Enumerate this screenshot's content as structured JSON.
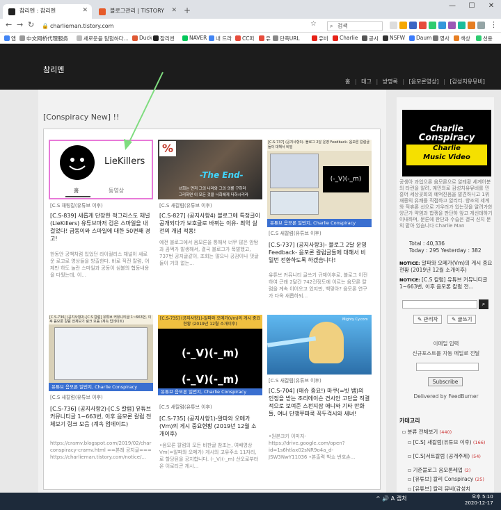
{
  "browser": {
    "tabs": [
      {
        "label": "참리멘 : 참리멘"
      },
      {
        "label": "블로그관리 | TISTORY"
      }
    ],
    "new_tab": "+",
    "url": "charlieman.tistory.com",
    "search_placeholder": "검색",
    "window_controls": [
      "—",
      "☐",
      "✕"
    ],
    "bookmarks": [
      "앱",
      "中文网桥代理服务",
      "새로운을 탐험하다...",
      "Duck",
      "잘리엔",
      "NAVER",
      "내 드라",
      "CC퍼",
      "유",
      "단축URL",
      "유비",
      "Charlie",
      "공시",
      "NSFW",
      "Daum",
      "영사",
      "색상",
      "선용"
    ]
  },
  "blog": {
    "title": "참리멘",
    "nav": [
      "홈",
      "태그",
      "방명록",
      "[음모론영상]",
      "[감성치유뮤비]"
    ],
    "nav_sep": "|"
  },
  "section": {
    "title": "[Conspiracy New] !!"
  },
  "posts": [
    {
      "thumb": {
        "channel": "LieKillers",
        "tab1": "홈",
        "tab2": "동영상"
      },
      "category": "[C.S 채팅칼(유튜브 이후)",
      "title": "[C.S-839] 새롭게 단장한 적그리스도 채널(LieKillers) 유튜브마저 검은 스마일을 내걸었다! 금동이와 스마일에 대한 50편째 경고!",
      "summary": "한동안 공백처럼 있었던 라이컬리스 채널이 새로운 로고로 영상들을 방출한다. 바로 직전 칼럼, 어제만 하도 놀란 스마일과 공동이 심볼의 협동내용을 다뤘는데, 이..."
    },
    {
      "thumb": {
        "badge": "%",
        "banner": "-The End-",
        "caption1": "녀희는 먼저 그의 나라와 그의 의를 구하라",
        "caption2": "그리하면 이 모든 것을 너희에게 더하시리라"
      },
      "category": "[C.S 새칼럼(유튜브 이후)",
      "title": "[C.S-827] (공지사항4) 블로그에 특정글이 공개되다가 보호글로 바뀌는 이유- 최악 실전의 개념 적용!",
      "summary": "예전 블로그에서 음모론을 통해서 너무 많은 암탐과 끔쩍가 발생해서, 결국 블로그가 폭발했고, 737번 공지글같이, 조회는 많으나 공감이나 댓글들이 거의 없는..."
    },
    {
      "thumb": {
        "header": "[C.S-737] (공지사항3)- 블로그 2달 운영 Feedback- 음모론 칼럼글들이 대해서 비밀",
        "mark": "(-_V)(-_m)",
        "footer": "유튜브 음모론 일번지, Charlie Conspiracy"
      },
      "category": "[C.S 새칼럼(유튜브 이후)",
      "title": "[C.S-737] (공지사항3)- 블로그 2달 운영 Feedback- 음모론 칼럼글들에 대해서 비밀번 전환하도록 하겠습니다!",
      "summary": "유튜브 커뮤니티 글쓰기 규제이후로, 블로그 이전하여 근래 2달간 742건정도에 이르는 음모론 칼럼을 계속 이어오고 있지만, 백맞아? 음모론 연구가 다옥 새롭하되..."
    },
    {
      "thumb": {
        "header": "[C.S-736] (공지사항2)-[C.S 칼럼] 유튜브 커뮤니티글 1~663번, 이후 음모론 칼럼 전체보기 링크 모음 (계속 업데이트)",
        "footer": "유튜브 음모론 일번지, Charlie Conspiracy"
      },
      "category": "[C.S 새칼럼(유튜브 이후)",
      "title": "[C.S-736] (공지사항2)-[C.S 칼럼] 유튜브 커뮤니티글 1~663번, 이후 음모론 칼럼 전체보기 링크 모음 (계속 업데이트)",
      "summary": "https://cramv.blogspot.com/2019/02/charlie-conspiracy-cramv.html ==본래 공지글=== https://charlieman.tistory.com/notice/..."
    },
    {
      "thumb": {
        "header": "[C.S-735] (공지사항1)-알파와 오메가(Vm)의 게시 중요현황 (2019년 12월 소개이후)",
        "mark1": "(-_V)(-_m)",
        "mark2": "(-_V)(-_m)",
        "footer": "유튜브 음모론 일번지, Charlie Conspiracy"
      },
      "category": "[C.S 새칼럼(유튜브 이후)",
      "title": "[C.S-735] (공지사항1)-알파와 오메가(Vm)의 게시 중요현황 (2019년 12월 소개이후)",
      "summary": "•음모론 칼럼의 모든 비판글 참조는, 여배영상 Vm(=알파와 오메가) 게시의 고유주소 11자리, 로 할당된을 공지합니다. (-_V)(-_m) 산오로부터 온 이로티콘 게시..."
    },
    {
      "thumb": {
        "watermark": "Mighty Cy.com"
      },
      "category": "[C.S 새칼럼(유튜브 이후)",
      "title": "[C.S-704] (애슈 중요!) 마쿠(=빗 뱀)의 인정을 받는 조리에이슨 견시안 고단을 직결적으로 보여준 스펀지잡 애니와 기타 만화들, 여너 단쟁쭈파쿡 꼭두걱시와 새녀!",
      "summary": "•원본크키 이미지- https://drive.google.com/open?id=1s6htlax02sNR9o4a_d-JSW3NwY11036 •본출력 박쇼 번호손..."
    }
  ],
  "sidebar": {
    "logo_line1": "Charlie",
    "logo_line2": "Conspiracy",
    "logo_line3": "Charlie",
    "logo_line4": "Music Video",
    "description": "공생아 과업으론 음모론으로 알레황 세계어분의 타런을 알려, 궤민의로 감성치유뮤비를 민흥어 세상곳회의 예억진음을 발견하니고 1위 재종의 유쾌를 직접하고 알리티. 향조의 세계와 적휴론 선으로 기우러가 있는것을 알려가한 양곤가 약염과 합쟁을 판단하 앞고 게신데하기 이내하며, 문론에 판단과 수습은 결국 신지 분의 맡아 있습니다 Charlie Man",
    "total": "Total : 40,336",
    "today": "Today : 295    Yesterday : 382",
    "notices": [
      {
        "tag": "NOTICE:",
        "text": "[C.S 칼럼] 유튜브 커뮤니티글 1~663번, 이후 음모론 칼럼 전..."
      },
      {
        "tag": "NOTICE:",
        "text": "알파와 오메가(Vm)의 게시 중요현황 (2019년 12월 소개이후)"
      }
    ],
    "admin_btn": "관리자",
    "write_btn": "글쓰기",
    "email_title": "이메일 입력",
    "email_desc": "신규포스트를 자동 메일로 전달",
    "subscribe_btn": "Subscribe",
    "delivered": "Delivered by FeedBurner",
    "category_title": "카테고리",
    "categories": [
      {
        "name": "분류 전체보기",
        "count": "(440)"
      },
      {
        "name": "[C.S] 새칼럼(유튜브 이후)",
        "count": "(166)"
      },
      {
        "name": "[C.S]서트칼럼 (공개주제)",
        "count": "(54)"
      },
      {
        "name": "기준블로그 음모론레업",
        "count": "(2)"
      },
      {
        "name": "[유튜브] 칼리 Conspiracy",
        "count": "(25)"
      },
      {
        "name": "[유튜브] 칼리 뮤비(감성치",
        "count": ""
      }
    ]
  },
  "taskbar": {
    "tray": "^ 🔊 A 캡처",
    "time": "오후 5:10",
    "date": "2020-12-17"
  },
  "colors": {
    "header_bg": "#1c1c1c",
    "accent_pink": "#e87ad8",
    "arrow_green": "#7fdc7f",
    "footer_bar": "#3a6fd0"
  }
}
